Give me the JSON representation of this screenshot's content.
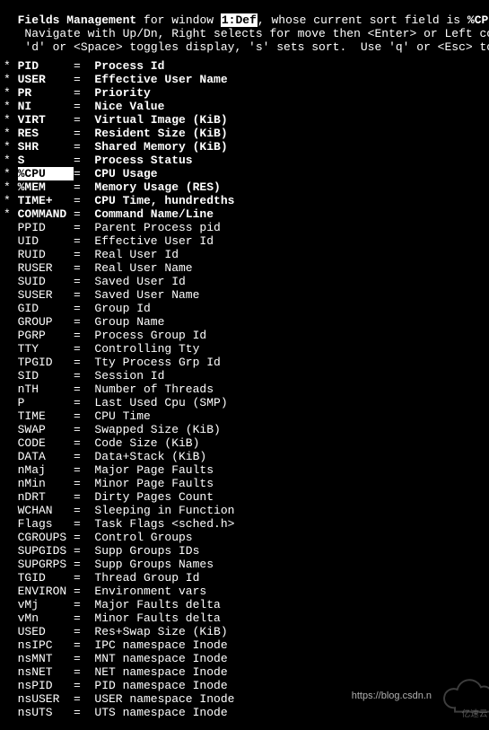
{
  "header": {
    "title": "Fields Management",
    "for_window_prefix": " for window ",
    "window_label": "1:Def",
    "whose_sort_prefix": ", whose current sort field is ",
    "sort_field": "%CPU",
    "help1": "   Navigate with Up/Dn, Right selects for move then <Enter> or Left commits,",
    "help2": "   'd' or <Space> toggles display, 's' sets sort.  Use 'q' or <Esc> to end!"
  },
  "fields": [
    {
      "on": true,
      "name": "PID",
      "desc": "Process Id",
      "current": false
    },
    {
      "on": true,
      "name": "USER",
      "desc": "Effective User Name",
      "current": false
    },
    {
      "on": true,
      "name": "PR",
      "desc": "Priority",
      "current": false
    },
    {
      "on": true,
      "name": "NI",
      "desc": "Nice Value",
      "current": false
    },
    {
      "on": true,
      "name": "VIRT",
      "desc": "Virtual Image (KiB)",
      "current": false
    },
    {
      "on": true,
      "name": "RES",
      "desc": "Resident Size (KiB)",
      "current": false
    },
    {
      "on": true,
      "name": "SHR",
      "desc": "Shared Memory (KiB)",
      "current": false
    },
    {
      "on": true,
      "name": "S",
      "desc": "Process Status",
      "current": false
    },
    {
      "on": true,
      "name": "%CPU",
      "desc": "CPU Usage",
      "current": true
    },
    {
      "on": true,
      "name": "%MEM",
      "desc": "Memory Usage (RES)",
      "current": false
    },
    {
      "on": true,
      "name": "TIME+",
      "desc": "CPU Time, hundredths",
      "current": false
    },
    {
      "on": true,
      "name": "COMMAND",
      "desc": "Command Name/Line",
      "current": false
    },
    {
      "on": false,
      "name": "PPID",
      "desc": "Parent Process pid",
      "current": false
    },
    {
      "on": false,
      "name": "UID",
      "desc": "Effective User Id",
      "current": false
    },
    {
      "on": false,
      "name": "RUID",
      "desc": "Real User Id",
      "current": false
    },
    {
      "on": false,
      "name": "RUSER",
      "desc": "Real User Name",
      "current": false
    },
    {
      "on": false,
      "name": "SUID",
      "desc": "Saved User Id",
      "current": false
    },
    {
      "on": false,
      "name": "SUSER",
      "desc": "Saved User Name",
      "current": false
    },
    {
      "on": false,
      "name": "GID",
      "desc": "Group Id",
      "current": false
    },
    {
      "on": false,
      "name": "GROUP",
      "desc": "Group Name",
      "current": false
    },
    {
      "on": false,
      "name": "PGRP",
      "desc": "Process Group Id",
      "current": false
    },
    {
      "on": false,
      "name": "TTY",
      "desc": "Controlling Tty",
      "current": false
    },
    {
      "on": false,
      "name": "TPGID",
      "desc": "Tty Process Grp Id",
      "current": false
    },
    {
      "on": false,
      "name": "SID",
      "desc": "Session Id",
      "current": false
    },
    {
      "on": false,
      "name": "nTH",
      "desc": "Number of Threads",
      "current": false
    },
    {
      "on": false,
      "name": "P",
      "desc": "Last Used Cpu (SMP)",
      "current": false
    },
    {
      "on": false,
      "name": "TIME",
      "desc": "CPU Time",
      "current": false
    },
    {
      "on": false,
      "name": "SWAP",
      "desc": "Swapped Size (KiB)",
      "current": false
    },
    {
      "on": false,
      "name": "CODE",
      "desc": "Code Size (KiB)",
      "current": false
    },
    {
      "on": false,
      "name": "DATA",
      "desc": "Data+Stack (KiB)",
      "current": false
    },
    {
      "on": false,
      "name": "nMaj",
      "desc": "Major Page Faults",
      "current": false
    },
    {
      "on": false,
      "name": "nMin",
      "desc": "Minor Page Faults",
      "current": false
    },
    {
      "on": false,
      "name": "nDRT",
      "desc": "Dirty Pages Count",
      "current": false
    },
    {
      "on": false,
      "name": "WCHAN",
      "desc": "Sleeping in Function",
      "current": false
    },
    {
      "on": false,
      "name": "Flags",
      "desc": "Task Flags <sched.h>",
      "current": false
    },
    {
      "on": false,
      "name": "CGROUPS",
      "desc": "Control Groups",
      "current": false
    },
    {
      "on": false,
      "name": "SUPGIDS",
      "desc": "Supp Groups IDs",
      "current": false
    },
    {
      "on": false,
      "name": "SUPGRPS",
      "desc": "Supp Groups Names",
      "current": false
    },
    {
      "on": false,
      "name": "TGID",
      "desc": "Thread Group Id",
      "current": false
    },
    {
      "on": false,
      "name": "ENVIRON",
      "desc": "Environment vars",
      "current": false
    },
    {
      "on": false,
      "name": "vMj",
      "desc": "Major Faults delta",
      "current": false
    },
    {
      "on": false,
      "name": "vMn",
      "desc": "Minor Faults delta",
      "current": false
    },
    {
      "on": false,
      "name": "USED",
      "desc": "Res+Swap Size (KiB)",
      "current": false
    },
    {
      "on": false,
      "name": "nsIPC",
      "desc": "IPC namespace Inode",
      "current": false
    },
    {
      "on": false,
      "name": "nsMNT",
      "desc": "MNT namespace Inode",
      "current": false
    },
    {
      "on": false,
      "name": "nsNET",
      "desc": "NET namespace Inode",
      "current": false
    },
    {
      "on": false,
      "name": "nsPID",
      "desc": "PID namespace Inode",
      "current": false
    },
    {
      "on": false,
      "name": "nsUSER",
      "desc": "USER namespace Inode",
      "current": false
    },
    {
      "on": false,
      "name": "nsUTS",
      "desc": "UTS namespace Inode",
      "current": false
    }
  ],
  "watermark": {
    "url": "https://blog.csdn.n",
    "brand": "亿速云"
  }
}
